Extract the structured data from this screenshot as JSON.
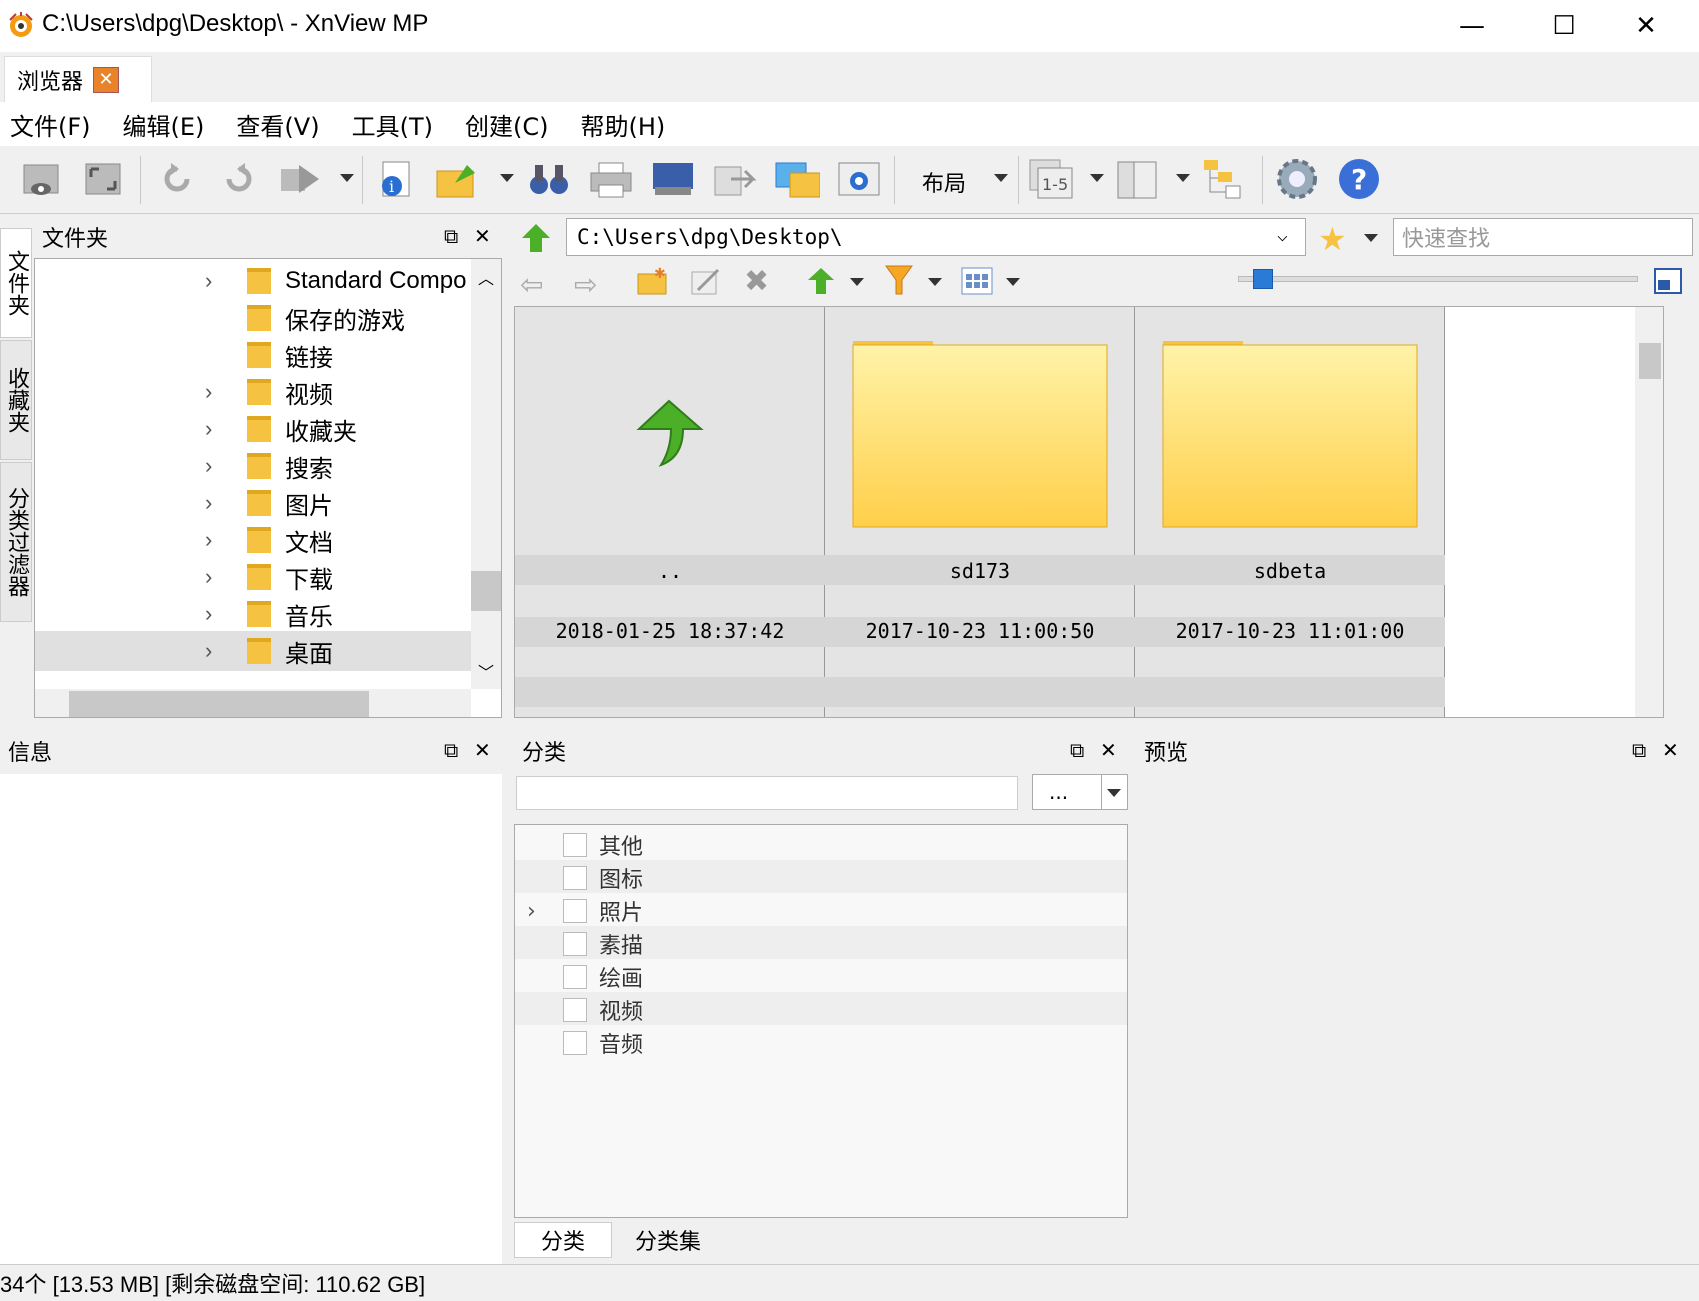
{
  "window": {
    "title": "C:\\Users\\dpg\\Desktop\\ - XnView MP",
    "minimize": "—",
    "maximize": "☐",
    "close": "✕"
  },
  "tabs": {
    "browser": "浏览器",
    "close": "✕"
  },
  "menu": [
    "文件(F)",
    "编辑(E)",
    "查看(V)",
    "工具(T)",
    "创建(C)",
    "帮助(H)"
  ],
  "toolbar": {
    "layout_label": "布局",
    "icons": [
      "view-icon",
      "fullscreen-icon",
      "rotate-left-icon",
      "rotate-right-icon",
      "transform-icon",
      "info-icon",
      "open-with-icon",
      "binoculars-icon",
      "print-icon",
      "scanner-icon",
      "export-icon",
      "convert-icon",
      "capture-icon",
      "batch-rename-icon",
      "book-icon",
      "tree-icon",
      "settings-icon",
      "help-icon"
    ]
  },
  "sidebar_tabs": [
    "文件夹",
    "收藏夹",
    "分类过滤器"
  ],
  "folders_panel": {
    "title": "文件夹",
    "items": [
      {
        "label": "Standard Compo",
        "expandable": true
      },
      {
        "label": "保存的游戏",
        "expandable": false
      },
      {
        "label": "链接",
        "expandable": false
      },
      {
        "label": "视频",
        "expandable": true
      },
      {
        "label": "收藏夹",
        "expandable": true
      },
      {
        "label": "搜索",
        "expandable": true
      },
      {
        "label": "图片",
        "expandable": true
      },
      {
        "label": "文档",
        "expandable": true
      },
      {
        "label": "下载",
        "expandable": true
      },
      {
        "label": "音乐",
        "expandable": true
      },
      {
        "label": "桌面",
        "expandable": true
      }
    ]
  },
  "address_bar": {
    "path": "C:\\Users\\dpg\\Desktop\\"
  },
  "quick_search": {
    "placeholder": "快速查找"
  },
  "thumbnails": [
    {
      "name": "..",
      "date": "2018-01-25 18:37:42",
      "kind": "parent"
    },
    {
      "name": "sd173",
      "date": "2017-10-23 11:00:50",
      "kind": "folder"
    },
    {
      "name": "sdbeta",
      "date": "2017-10-23 11:01:00",
      "kind": "folder"
    }
  ],
  "info_panel": {
    "title": "信息"
  },
  "category_panel": {
    "title": "分类",
    "button": "...",
    "items": [
      "其他",
      "图标",
      "照片",
      "素描",
      "绘画",
      "视频",
      "音频"
    ],
    "tabs": [
      "分类",
      "分类集"
    ]
  },
  "preview_panel": {
    "title": "预览"
  },
  "status_bar": {
    "text": "34个 [13.53 MB] [剩余磁盘空间: 110.62 GB]"
  },
  "colors": {
    "folder_yellow": "#ffd54f",
    "accent_blue": "#2a7ad8",
    "arrow_green": "#4caf28"
  }
}
